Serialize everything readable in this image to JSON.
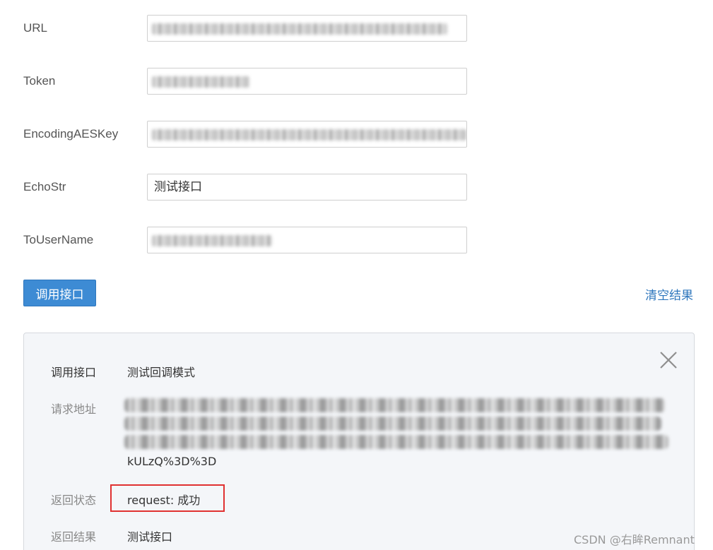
{
  "form": {
    "url": {
      "label": "URL",
      "value": ""
    },
    "token": {
      "label": "Token",
      "value": ""
    },
    "encoding_aes_key": {
      "label": "EncodingAESKey",
      "value": ""
    },
    "echo_str": {
      "label": "EchoStr",
      "value": "测试接口"
    },
    "to_user_name": {
      "label": "ToUserName",
      "value": ""
    }
  },
  "actions": {
    "call_button_label": "调用接口",
    "clear_link_label": "清空结果"
  },
  "result": {
    "call_interface_label": "调用接口",
    "call_interface_value": "测试回调模式",
    "request_url_label": "请求地址",
    "request_url_tail": "kULzQ%3D%3D",
    "return_status_label": "返回状态",
    "return_status_value": "request: 成功",
    "return_result_label": "返回结果",
    "return_result_value": "测试接口"
  },
  "watermark": "CSDN @右眸Remnant",
  "colors": {
    "primary": "#3d8bd4",
    "link": "#2f77bd",
    "highlight_border": "#e03131"
  },
  "icons": {
    "close": "close-icon"
  }
}
